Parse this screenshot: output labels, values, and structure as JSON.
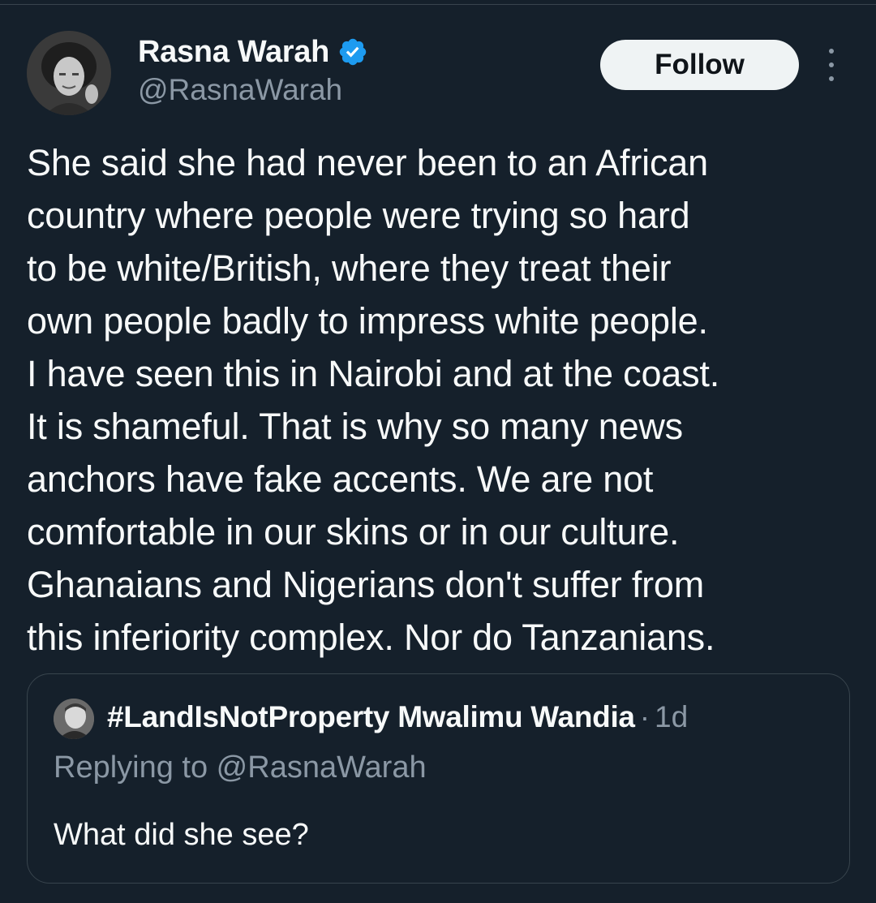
{
  "tweet": {
    "author": {
      "display_name": "Rasna Warah",
      "handle": "@RasnaWarah",
      "verified": true
    },
    "follow_label": "Follow",
    "text": "She said she had never been to an African\ncountry where people were trying so hard\nto be white/British, where they treat their\nown people badly to impress white people.\nI have seen this in Nairobi and at the coast.\nIt is shameful. That is why so many news\nanchors have fake accents. We are not\ncomfortable in our skins or in our culture.\nGhanaians and Nigerians don't suffer from\nthis inferiority complex. Nor do Tanzanians."
  },
  "quote": {
    "display_name": "#LandIsNotProperty Mwalimu Wandia",
    "separator": "·",
    "time": "1d",
    "replying_prefix": "Replying to ",
    "replying_handle": "@RasnaWarah",
    "text": "What did she see?"
  },
  "colors": {
    "background": "#15202b",
    "text_primary": "#f7f9f9",
    "text_secondary": "#8b98a5",
    "border": "#38444d",
    "verified_badge": "#1d9bf0",
    "follow_button_bg": "#eff3f4"
  },
  "icons": {
    "verified": "verified-badge-icon",
    "more": "more-options-icon"
  }
}
